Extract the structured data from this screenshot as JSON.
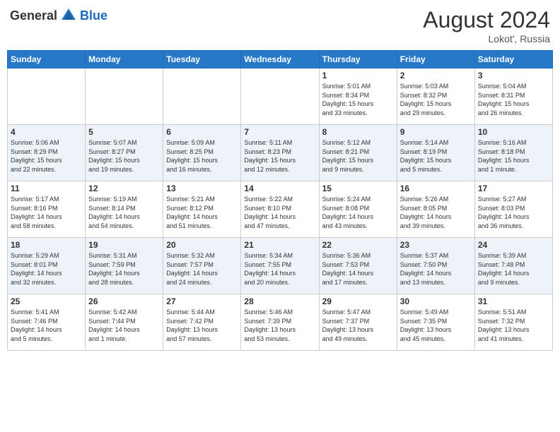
{
  "header": {
    "logo_general": "General",
    "logo_blue": "Blue",
    "month_year": "August 2024",
    "location": "Lokot', Russia"
  },
  "weekdays": [
    "Sunday",
    "Monday",
    "Tuesday",
    "Wednesday",
    "Thursday",
    "Friday",
    "Saturday"
  ],
  "weeks": [
    [
      {
        "day": "",
        "info": ""
      },
      {
        "day": "",
        "info": ""
      },
      {
        "day": "",
        "info": ""
      },
      {
        "day": "",
        "info": ""
      },
      {
        "day": "1",
        "info": "Sunrise: 5:01 AM\nSunset: 8:34 PM\nDaylight: 15 hours\nand 33 minutes."
      },
      {
        "day": "2",
        "info": "Sunrise: 5:03 AM\nSunset: 8:32 PM\nDaylight: 15 hours\nand 29 minutes."
      },
      {
        "day": "3",
        "info": "Sunrise: 5:04 AM\nSunset: 8:31 PM\nDaylight: 15 hours\nand 26 minutes."
      }
    ],
    [
      {
        "day": "4",
        "info": "Sunrise: 5:06 AM\nSunset: 8:29 PM\nDaylight: 15 hours\nand 22 minutes."
      },
      {
        "day": "5",
        "info": "Sunrise: 5:07 AM\nSunset: 8:27 PM\nDaylight: 15 hours\nand 19 minutes."
      },
      {
        "day": "6",
        "info": "Sunrise: 5:09 AM\nSunset: 8:25 PM\nDaylight: 15 hours\nand 16 minutes."
      },
      {
        "day": "7",
        "info": "Sunrise: 5:11 AM\nSunset: 8:23 PM\nDaylight: 15 hours\nand 12 minutes."
      },
      {
        "day": "8",
        "info": "Sunrise: 5:12 AM\nSunset: 8:21 PM\nDaylight: 15 hours\nand 9 minutes."
      },
      {
        "day": "9",
        "info": "Sunrise: 5:14 AM\nSunset: 8:19 PM\nDaylight: 15 hours\nand 5 minutes."
      },
      {
        "day": "10",
        "info": "Sunrise: 5:16 AM\nSunset: 8:18 PM\nDaylight: 15 hours\nand 1 minute."
      }
    ],
    [
      {
        "day": "11",
        "info": "Sunrise: 5:17 AM\nSunset: 8:16 PM\nDaylight: 14 hours\nand 58 minutes."
      },
      {
        "day": "12",
        "info": "Sunrise: 5:19 AM\nSunset: 8:14 PM\nDaylight: 14 hours\nand 54 minutes."
      },
      {
        "day": "13",
        "info": "Sunrise: 5:21 AM\nSunset: 8:12 PM\nDaylight: 14 hours\nand 51 minutes."
      },
      {
        "day": "14",
        "info": "Sunrise: 5:22 AM\nSunset: 8:10 PM\nDaylight: 14 hours\nand 47 minutes."
      },
      {
        "day": "15",
        "info": "Sunrise: 5:24 AM\nSunset: 8:08 PM\nDaylight: 14 hours\nand 43 minutes."
      },
      {
        "day": "16",
        "info": "Sunrise: 5:26 AM\nSunset: 8:05 PM\nDaylight: 14 hours\nand 39 minutes."
      },
      {
        "day": "17",
        "info": "Sunrise: 5:27 AM\nSunset: 8:03 PM\nDaylight: 14 hours\nand 36 minutes."
      }
    ],
    [
      {
        "day": "18",
        "info": "Sunrise: 5:29 AM\nSunset: 8:01 PM\nDaylight: 14 hours\nand 32 minutes."
      },
      {
        "day": "19",
        "info": "Sunrise: 5:31 AM\nSunset: 7:59 PM\nDaylight: 14 hours\nand 28 minutes."
      },
      {
        "day": "20",
        "info": "Sunrise: 5:32 AM\nSunset: 7:57 PM\nDaylight: 14 hours\nand 24 minutes."
      },
      {
        "day": "21",
        "info": "Sunrise: 5:34 AM\nSunset: 7:55 PM\nDaylight: 14 hours\nand 20 minutes."
      },
      {
        "day": "22",
        "info": "Sunrise: 5:36 AM\nSunset: 7:53 PM\nDaylight: 14 hours\nand 17 minutes."
      },
      {
        "day": "23",
        "info": "Sunrise: 5:37 AM\nSunset: 7:50 PM\nDaylight: 14 hours\nand 13 minutes."
      },
      {
        "day": "24",
        "info": "Sunrise: 5:39 AM\nSunset: 7:48 PM\nDaylight: 14 hours\nand 9 minutes."
      }
    ],
    [
      {
        "day": "25",
        "info": "Sunrise: 5:41 AM\nSunset: 7:46 PM\nDaylight: 14 hours\nand 5 minutes."
      },
      {
        "day": "26",
        "info": "Sunrise: 5:42 AM\nSunset: 7:44 PM\nDaylight: 14 hours\nand 1 minute."
      },
      {
        "day": "27",
        "info": "Sunrise: 5:44 AM\nSunset: 7:42 PM\nDaylight: 13 hours\nand 57 minutes."
      },
      {
        "day": "28",
        "info": "Sunrise: 5:46 AM\nSunset: 7:39 PM\nDaylight: 13 hours\nand 53 minutes."
      },
      {
        "day": "29",
        "info": "Sunrise: 5:47 AM\nSunset: 7:37 PM\nDaylight: 13 hours\nand 49 minutes."
      },
      {
        "day": "30",
        "info": "Sunrise: 5:49 AM\nSunset: 7:35 PM\nDaylight: 13 hours\nand 45 minutes."
      },
      {
        "day": "31",
        "info": "Sunrise: 5:51 AM\nSunset: 7:32 PM\nDaylight: 13 hours\nand 41 minutes."
      }
    ]
  ]
}
